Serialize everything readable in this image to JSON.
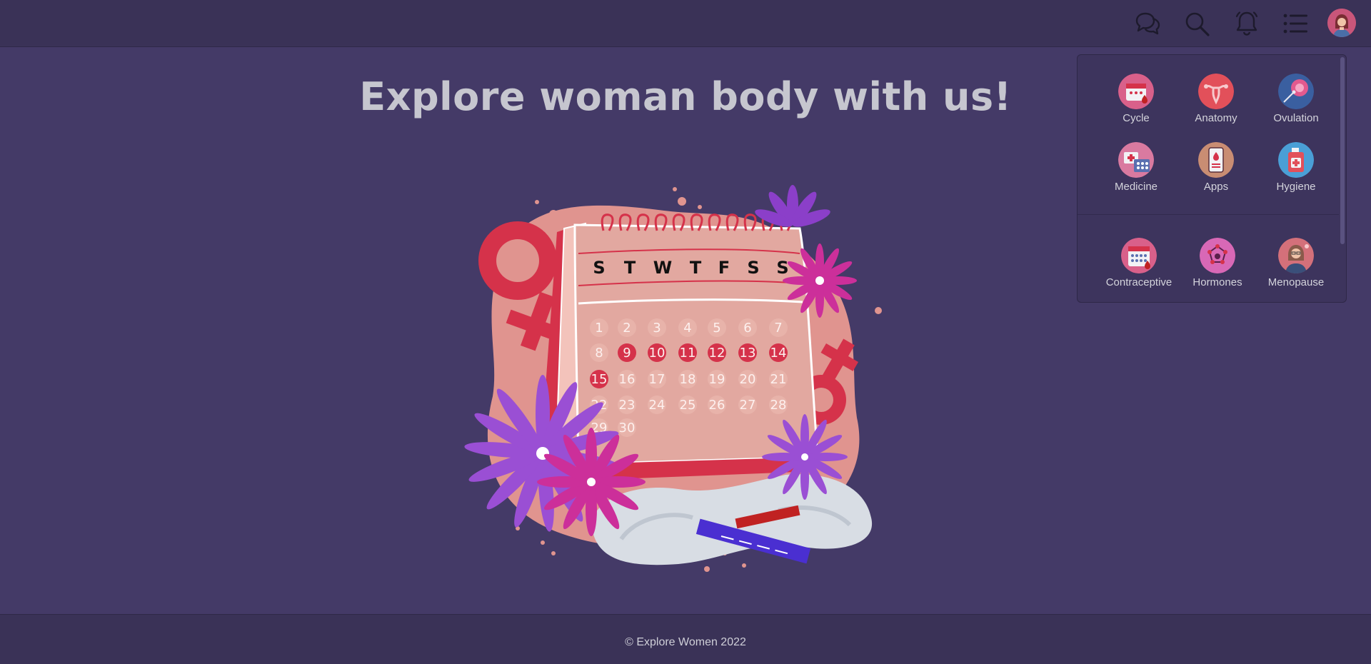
{
  "header": {
    "icons": [
      {
        "name": "chat-icon"
      },
      {
        "name": "search-icon"
      },
      {
        "name": "bell-icon"
      },
      {
        "name": "menu-list-icon"
      }
    ]
  },
  "main": {
    "title": "Explore woman body with us!",
    "calendar": {
      "weekdays": [
        "S",
        "T",
        "W",
        "T",
        "F",
        "S",
        "S"
      ],
      "days": [
        "1",
        "2",
        "3",
        "4",
        "5",
        "6",
        "7",
        "8",
        "9",
        "10",
        "11",
        "12",
        "13",
        "14",
        "15",
        "16",
        "17",
        "18",
        "19",
        "20",
        "21",
        "22",
        "23",
        "24",
        "25",
        "26",
        "27",
        "28",
        "29",
        "30"
      ],
      "highlighted_days": [
        "9",
        "10",
        "11",
        "12",
        "13",
        "14",
        "15"
      ]
    }
  },
  "menu": {
    "items": [
      {
        "label": "Cycle"
      },
      {
        "label": "Anatomy"
      },
      {
        "label": "Ovulation"
      },
      {
        "label": "Medicine"
      },
      {
        "label": "Apps"
      },
      {
        "label": "Hygiene"
      },
      {
        "label": "Contraceptive"
      },
      {
        "label": "Hormones"
      },
      {
        "label": "Menopause"
      }
    ]
  },
  "footer": {
    "text": "© Explore Women 2022"
  },
  "colors": {
    "background": "#443a67",
    "bar": "#3a3257",
    "accent_red": "#d5324a",
    "calendar_pink": "#e2a8a0"
  }
}
